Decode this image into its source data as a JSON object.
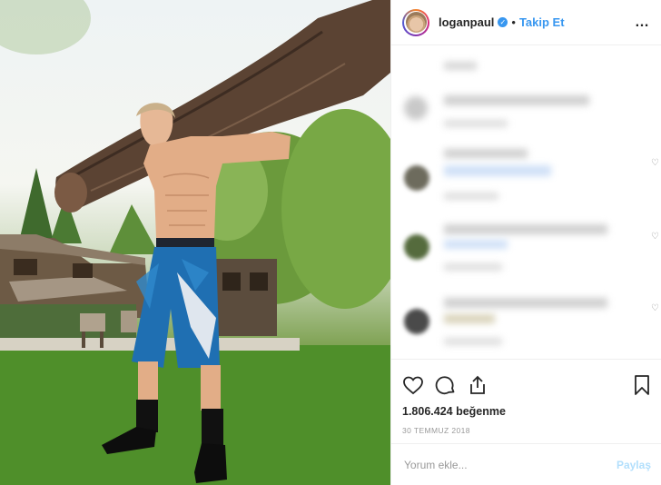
{
  "header": {
    "username": "loganpaul",
    "verified_icon": "verified-badge-icon",
    "separator": "•",
    "follow_label": "Takip Et",
    "more_label": "…"
  },
  "colors": {
    "link_blue": "#3897f0",
    "post_button_disabled": "#b2dffc",
    "border": "#efefef",
    "muted": "#999999"
  },
  "actions": {
    "like_icon": "heart-icon",
    "comment_icon": "comment-icon",
    "share_icon": "share-icon",
    "save_icon": "bookmark-icon"
  },
  "likes_text": "1.806.424 beğenme",
  "date_text": "30 TEMMUZ 2018",
  "add_comment": {
    "placeholder": "Yorum ekle...",
    "post_label": "Paylaş"
  }
}
